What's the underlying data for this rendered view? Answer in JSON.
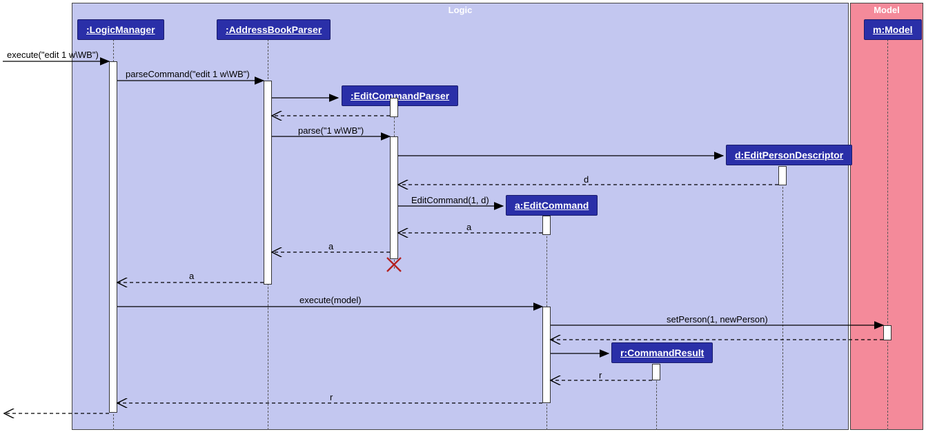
{
  "chart_data": {
    "type": "sequence-diagram",
    "frames": [
      {
        "name": "Logic",
        "participants": [
          ":LogicManager",
          ":AddressBookParser",
          ":EditCommandParser",
          "d:EditPersonDescriptor",
          "a:EditCommand",
          "r:CommandResult"
        ]
      },
      {
        "name": "Model",
        "participants": [
          "m:Model"
        ]
      }
    ],
    "messages": [
      {
        "from": "caller",
        "to": ":LogicManager",
        "label": "execute(\"edit 1 w\\WB\")",
        "style": "solid"
      },
      {
        "from": ":LogicManager",
        "to": ":AddressBookParser",
        "label": "parseCommand(\"edit 1 w\\WB\")",
        "style": "solid"
      },
      {
        "from": ":AddressBookParser",
        "to": ":EditCommandParser",
        "label": "",
        "style": "solid",
        "create": true
      },
      {
        "from": ":EditCommandParser",
        "to": ":AddressBookParser",
        "label": "",
        "style": "dashed"
      },
      {
        "from": ":AddressBookParser",
        "to": ":EditCommandParser",
        "label": "parse(\"1 w\\WB\")",
        "style": "solid"
      },
      {
        "from": ":EditCommandParser",
        "to": "d:EditPersonDescriptor",
        "label": "",
        "style": "solid",
        "create": true
      },
      {
        "from": "d:EditPersonDescriptor",
        "to": ":EditCommandParser",
        "label": "d",
        "style": "dashed"
      },
      {
        "from": ":EditCommandParser",
        "to": "a:EditCommand",
        "label": "EditCommand(1, d)",
        "style": "solid",
        "create": true
      },
      {
        "from": "a:EditCommand",
        "to": ":EditCommandParser",
        "label": "a",
        "style": "dashed"
      },
      {
        "from": ":EditCommandParser",
        "to": ":AddressBookParser",
        "label": "a",
        "style": "dashed"
      },
      {
        "from": ":EditCommandParser",
        "to": null,
        "label": "",
        "style": "destroy"
      },
      {
        "from": ":AddressBookParser",
        "to": ":LogicManager",
        "label": "a",
        "style": "dashed"
      },
      {
        "from": ":LogicManager",
        "to": "a:EditCommand",
        "label": "execute(model)",
        "style": "solid"
      },
      {
        "from": "a:EditCommand",
        "to": "m:Model",
        "label": "setPerson(1, newPerson)",
        "style": "solid"
      },
      {
        "from": "m:Model",
        "to": "a:EditCommand",
        "label": "",
        "style": "dashed"
      },
      {
        "from": "a:EditCommand",
        "to": "r:CommandResult",
        "label": "",
        "style": "solid",
        "create": true
      },
      {
        "from": "r:CommandResult",
        "to": "a:EditCommand",
        "label": "r",
        "style": "dashed"
      },
      {
        "from": "a:EditCommand",
        "to": ":LogicManager",
        "label": "r",
        "style": "dashed"
      },
      {
        "from": ":LogicManager",
        "to": "caller",
        "label": "",
        "style": "dashed"
      }
    ]
  },
  "frames": {
    "logic": {
      "label": "Logic"
    },
    "model": {
      "label": "Model"
    }
  },
  "participants": {
    "logic_manager": ":LogicManager",
    "address_book_parser": ":AddressBookParser",
    "edit_command_parser": ":EditCommandParser",
    "edit_person_descriptor": "d:EditPersonDescriptor",
    "edit_command": "a:EditCommand",
    "command_result": "r:CommandResult",
    "model": "m:Model"
  },
  "messages": {
    "m1": "execute(\"edit 1 w\\WB\")",
    "m2": "parseCommand(\"edit 1 w\\WB\")",
    "m5": "parse(\"1 w\\WB\")",
    "m7": "d",
    "m8": "EditCommand(1, d)",
    "m9": "a",
    "m10": "a",
    "m12": "a",
    "m13": "execute(model)",
    "m14": "setPerson(1, newPerson)",
    "m17": "r",
    "m18": "r"
  }
}
